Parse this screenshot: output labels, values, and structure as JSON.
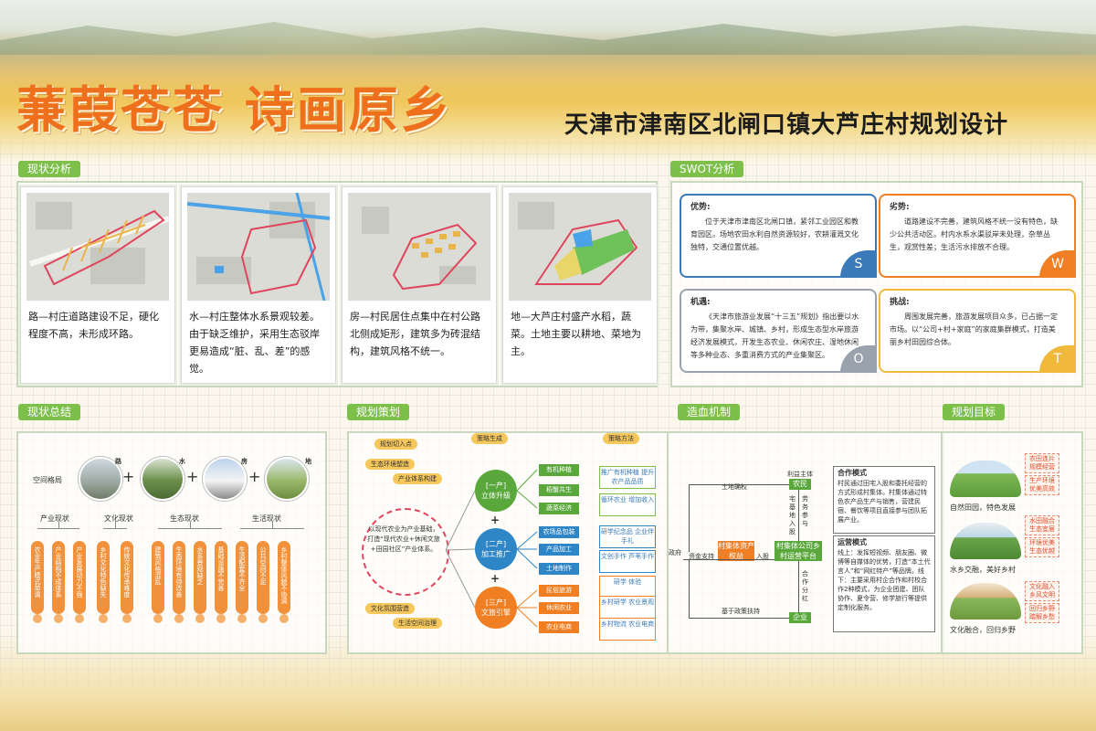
{
  "header": {
    "title_main": "蒹葭苍苍 诗画原乡",
    "title_sub": "天津市津南区北闸口镇大芦庄村规划设计"
  },
  "sections": {
    "status": "现状分析",
    "swot": "SWOT分析",
    "summary": "现状总结",
    "strategy": "规划策划",
    "mechanism": "造血机制",
    "goal": "规划目标"
  },
  "status_cards": [
    {
      "text": "路—村庄道路建设不足，硬化程度不高，未形成环路。"
    },
    {
      "text": "水—村庄整体水系景观较差。由于缺乏维护，采用生态驳岸更易造成“脏、乱、差”的感觉。"
    },
    {
      "text": "房—村民居住点集中在村公路北侧成矩形，建筑多为砖混结构，建筑风格不统一。"
    },
    {
      "text": "地—大芦庄村盛产水稻，蔬菜。土地主要以耕地、菜地为主。"
    }
  ],
  "swot": {
    "s": {
      "title": "优势:",
      "body": "位于天津市津南区北闸口镇，紧邻工业园区和教育园区。场地农田水利自然资源较好，农耕灌溉文化独特，交通位置优越。",
      "letter": "S"
    },
    "w": {
      "title": "劣势:",
      "body": "道路建设不完善，建筑风格不统一没有特色，缺少公共活动区。村内水系水渠驳岸未处理，杂草丛生，观赏性差；生活污水排放不合理。",
      "letter": "W"
    },
    "o": {
      "title": "机遇:",
      "body": "《天津市旅游业发展“十三五”规划》指出要以水为带，集聚水岸、城镇、乡村，形成生态型水岸旅游经济发展模式，开发生态农业、休闲农庄、湿地休闲等多种业态、多重消费方式的产业集聚区。",
      "letter": "O"
    },
    "t": {
      "title": "挑战:",
      "body": "周围发展完善，旅游发展项目众多，已占据一定市场。以“公司+村+家庭”的家庭集群模式，打造美丽乡村田园综合体。",
      "letter": "T"
    }
  },
  "summary": {
    "layout_label": "空间格局",
    "circles": [
      "路",
      "水",
      "房",
      "地"
    ],
    "groups": [
      "产业现状",
      "文化现状",
      "生态现状",
      "生活现状"
    ],
    "pills": [
      "农业生产模式单调",
      "产业结构不成体系",
      "产业发展动力不强",
      "乡村文化特色缺失",
      "传统文化传承难度",
      "建筑风格混乱",
      "生态环境有待改善",
      "水系景观缺乏",
      "基础设施不完善",
      "生活配套不齐全",
      "公共空间不足",
      "乡村整体风貌不协调"
    ]
  },
  "strategy": {
    "labels": {
      "entry": "规划切入点",
      "gen": "策略生成",
      "method": "策略方法"
    },
    "left_tags": [
      "生态环境塑造",
      "产业体系构建",
      "文化氛围营造",
      "生活空间治理"
    ],
    "circle_text": "以现代农业为产业基础，打造“现代农业+休闲文旅+田园社区”产业体系。",
    "nodes": [
      {
        "label": "[一产]",
        "name": "立体升级",
        "color": "#5aa83c"
      },
      {
        "label": "[二产]",
        "name": "加工推广",
        "color": "#2f86c6"
      },
      {
        "label": "[三产]",
        "name": "文旅引擎",
        "color": "#ef7f22"
      }
    ],
    "tags": [
      {
        "text": "有机种植",
        "color": "#5aa83c"
      },
      {
        "text": "稻蟹共生",
        "color": "#5aa83c"
      },
      {
        "text": "蔬菜经济",
        "color": "#5aa83c"
      },
      {
        "text": "农场品包装",
        "color": "#2f86c6"
      },
      {
        "text": "产品加工",
        "color": "#2f86c6"
      },
      {
        "text": "土地制作",
        "color": "#2f86c6"
      },
      {
        "text": "民俗旅游",
        "color": "#ef7f22"
      },
      {
        "text": "休闲农业",
        "color": "#ef7f22"
      },
      {
        "text": "农业电商",
        "color": "#ef7f22"
      }
    ],
    "methods": [
      "推广有机种植 提升农产品品质",
      "循环农业 增加收入",
      "研学纪念品 企业伴手礼",
      "文创手作 芦苇手作",
      "研学 体验",
      "乡村研学 农业景观",
      "乡村物流 农业电商"
    ]
  },
  "mechanism": {
    "subject": "利益主体",
    "villager": "农民",
    "land": "土地确权",
    "gov": "政府",
    "fund": "资金支持",
    "rights": "村集体资产权益",
    "invest": "入股",
    "platform": "村集体公司乡村运营平台",
    "enterprise": "企业",
    "policy": "基于政策扶持",
    "v1": "宅基地入股",
    "v2": "劳务参与",
    "v3": "合作分红",
    "coop_title": "合作模式",
    "coop_body": "村民通过田宅入股和委托经营的方式形成村集体。村集体通过特色农产品生产与销售，营建民宿、餐饮等项目直接参与团队拓展产业。",
    "ops_title": "运营模式",
    "ops_body": "线上：发挥短视频、朋友圈、微博等自媒体的优势，打造“本土代言人”和“网红特产”等品牌。线下：主要采用村企合作和村校合作2种模式，为企业团建、团队协作、夏令营、修学旅行等提供定制化服务。"
  },
  "goal": {
    "items": [
      {
        "caption": "自然田园，特色发展",
        "tags": [
          "农田连片 规模经营",
          "生产环境 优美高效"
        ]
      },
      {
        "caption": "水乡交融，美好乡村",
        "tags": [
          "水田融合 生态宜居",
          "环境优美 生态优越"
        ]
      },
      {
        "caption": "文化融合，回归乡野",
        "tags": [
          "文化融入 乡风文明",
          "回归乡野 踏解乡愁"
        ]
      }
    ]
  }
}
